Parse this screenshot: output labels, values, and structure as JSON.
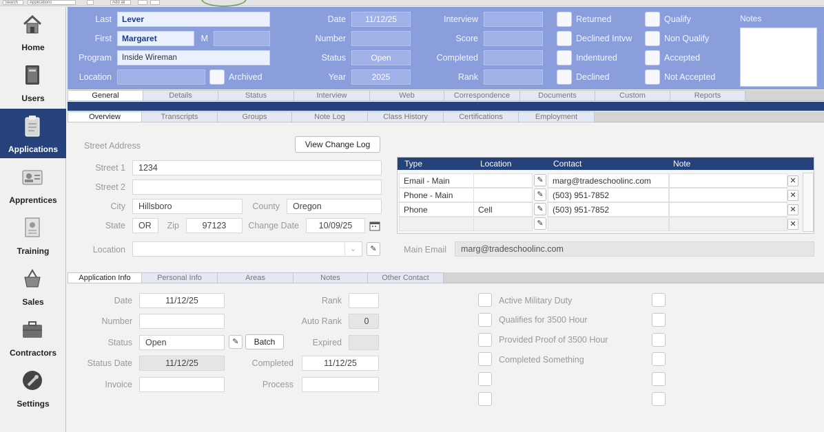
{
  "topbar": {
    "mini1": "Search",
    "mini2": "Applications",
    "mini3": "Add all"
  },
  "sidebar": {
    "items": [
      {
        "label": "Home",
        "icon": "house-icon"
      },
      {
        "label": "Users",
        "icon": "book-icon"
      },
      {
        "label": "Applications",
        "icon": "clipboard-icon",
        "active": true
      },
      {
        "label": "Apprentices",
        "icon": "id-card-icon"
      },
      {
        "label": "Training",
        "icon": "certificate-icon"
      },
      {
        "label": "Sales",
        "icon": "basket-icon"
      },
      {
        "label": "Contractors",
        "icon": "briefcase-icon"
      },
      {
        "label": "Settings",
        "icon": "wrench-icon"
      }
    ]
  },
  "header": {
    "last_label": "Last",
    "last_value": "Lever",
    "first_label": "First",
    "first_value": "Margaret",
    "m_label": "M",
    "m_value": "",
    "program_label": "Program",
    "program_value": "Inside Wireman",
    "location_label": "Location",
    "location_value": "",
    "archived_label": "Archived",
    "date_label": "Date",
    "date_value": "11/12/25",
    "number_label": "Number",
    "number_value": "",
    "status_label": "Status",
    "status_value": "Open",
    "year_label": "Year",
    "year_value": "2025",
    "interview_label": "Interview",
    "interview_value": "",
    "score_label": "Score",
    "score_value": "",
    "completed_label": "Completed",
    "completed_value": "",
    "rank_label": "Rank",
    "rank_value": "",
    "checks_col1": [
      "Returned",
      "Declined Intvw",
      "Indentured",
      "Declined"
    ],
    "checks_col2": [
      "Qualify",
      "Non Qualify",
      "Accepted",
      "Not Accepted"
    ],
    "notes_label": "Notes"
  },
  "tabs_main": [
    "General",
    "Details",
    "Status",
    "Interview",
    "Web",
    "Correspondence",
    "Documents",
    "Custom",
    "Reports"
  ],
  "tabs_sub": [
    "Overview",
    "Transcripts",
    "Groups",
    "Note Log",
    "Class History",
    "Certifications",
    "Employment"
  ],
  "address": {
    "section_label": "Street Address",
    "view_change_log": "View Change Log",
    "street1_label": "Street 1",
    "street1_value": "1234",
    "street2_label": "Street 2",
    "street2_value": "",
    "city_label": "City",
    "city_value": "Hillsboro",
    "county_label": "County",
    "county_value": "Oregon",
    "state_label": "State",
    "state_value": "OR",
    "zip_label": "Zip",
    "zip_value": "97123",
    "change_date_label": "Change Date",
    "change_date_value": "10/09/25",
    "location_label": "Location",
    "location_value": ""
  },
  "contacts": {
    "headers": [
      "Type",
      "Location",
      "Contact",
      "Note"
    ],
    "rows": [
      {
        "type": "Email - Main",
        "location": "",
        "contact": "marg@tradeschoolinc.com",
        "note": ""
      },
      {
        "type": "Phone - Main",
        "location": "",
        "contact": "(503) 951-7852",
        "note": ""
      },
      {
        "type": "Phone",
        "location": "Cell",
        "contact": "(503) 951-7852",
        "note": ""
      },
      {
        "type": "",
        "location": "",
        "contact": "",
        "note": ""
      }
    ],
    "main_email_label": "Main Email",
    "main_email_value": "marg@tradeschoolinc.com"
  },
  "tabs_info": [
    "Application Info",
    "Personal Info",
    "Areas",
    "Notes",
    "Other Contact"
  ],
  "appinfo": {
    "date_label": "Date",
    "date_value": "11/12/25",
    "number_label": "Number",
    "number_value": "",
    "status_label": "Status",
    "status_value": "Open",
    "batch_label": "Batch",
    "status_date_label": "Status Date",
    "status_date_value": "11/12/25",
    "invoice_label": "Invoice",
    "invoice_value": "",
    "rank_label": "Rank",
    "rank_value": "",
    "auto_rank_label": "Auto Rank",
    "auto_rank_value": "0",
    "expired_label": "Expired",
    "expired_value": "",
    "completed_label": "Completed",
    "completed_value": "11/12/25",
    "process_label": "Process",
    "process_value": "",
    "checks": [
      "Active Military Duty",
      "Qualifies for 3500 Hour",
      "Provided Proof of 3500 Hour",
      "Completed Something",
      "",
      ""
    ]
  }
}
